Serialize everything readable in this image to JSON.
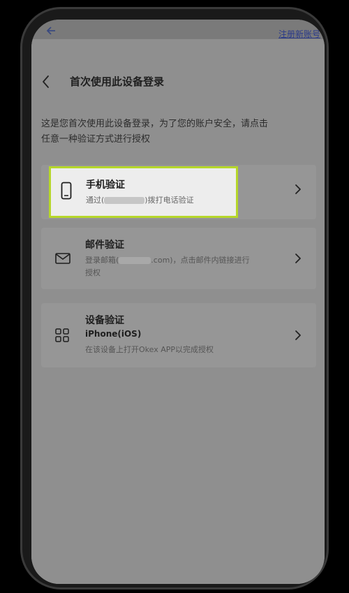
{
  "background_nav": {
    "back_icon": "back-arrow-icon",
    "register_link": "注册新账号"
  },
  "header": {
    "back_icon": "chevron-left-icon",
    "title": "首次使用此设备登录"
  },
  "intro": {
    "line1": "这是您首次使用此设备登录，为了您的账户安全，请点击",
    "line2": "任意一种验证方式进行授权"
  },
  "options": [
    {
      "icon": "phone-icon",
      "title": "手机验证",
      "sub_prefix": "通过(",
      "sub_suffix": ")拨打电话验证",
      "highlighted": true,
      "highlight_color": "#b6d72a"
    },
    {
      "icon": "mail-icon",
      "title": "邮件验证",
      "sub_prefix": "登录邮箱(",
      "sub_domain": ".com",
      "sub_suffix": ")，点击邮件内链接进行",
      "sub_line2": "授权"
    },
    {
      "icon": "grid-icon",
      "title": "设备验证",
      "device": "iPhone(iOS)",
      "sub": "在该设备上打开Okex APP以完成授权"
    }
  ],
  "colors": {
    "screen_bg": "#8f8f8f",
    "card_bg": "#969696",
    "highlight_border": "#b6d72a",
    "highlight_bg": "#ededed"
  }
}
